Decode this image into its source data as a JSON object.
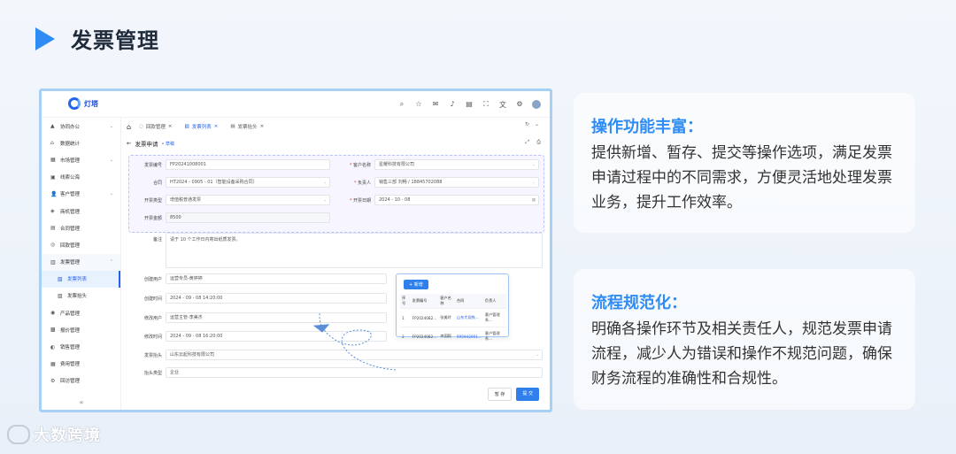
{
  "header": {
    "title": "发票管理"
  },
  "app": {
    "logo_text": "灯塔",
    "sidebar": [
      {
        "icon": "▲",
        "label": "协同办公",
        "chev": "⌄"
      },
      {
        "icon": "⌂",
        "label": "数据统计",
        "chev": ""
      },
      {
        "icon": "▦",
        "label": "市场管理",
        "chev": "⌄"
      },
      {
        "icon": "▣",
        "label": "线索公海",
        "chev": ""
      },
      {
        "icon": "👤",
        "label": "客户管理",
        "chev": "⌄"
      },
      {
        "icon": "◈",
        "label": "商机管理",
        "chev": ""
      },
      {
        "icon": "▤",
        "label": "合同管理",
        "chev": ""
      },
      {
        "icon": "◎",
        "label": "回款管理",
        "chev": ""
      },
      {
        "icon": "▥",
        "label": "发票管理",
        "chev": "⌃"
      },
      {
        "icon": "▧",
        "label": "发票列表",
        "chev": ""
      },
      {
        "icon": "▨",
        "label": "发票抬头",
        "chev": ""
      },
      {
        "icon": "◉",
        "label": "产品管理",
        "chev": ""
      },
      {
        "icon": "▩",
        "label": "报价管理",
        "chev": ""
      },
      {
        "icon": "◐",
        "label": "销售管理",
        "chev": ""
      },
      {
        "icon": "▦",
        "label": "费用管理",
        "chev": ""
      },
      {
        "icon": "⚙",
        "label": "回访管理",
        "chev": ""
      }
    ],
    "collapse": "«",
    "tabs": [
      {
        "label": "回款管理",
        "close": "×"
      },
      {
        "label": "发票列表",
        "close": "×"
      },
      {
        "label": "发票抬头",
        "close": "×"
      }
    ],
    "page_title": "发票申请",
    "draft_badge": "• 草稿",
    "form": {
      "invoice_no_label": "发票编号",
      "invoice_no": "FP20241008001",
      "customer_label": "客户名称",
      "customer": "星耀科技有限公司",
      "contract_label": "合同",
      "contract": "HT2024 - 0905 - 01（智能设备采购合同）",
      "owner_label": "负责人",
      "owner": "销售三部 刘畅 / 18845702088",
      "type_label": "开票类型",
      "type": "增值税普通发票",
      "date_label": "开票日期",
      "date": "2024 - 10 - 08",
      "amount_label": "开票金额",
      "amount": "8500",
      "remark_label": "备注",
      "remark": "请于 10 个工作日内寄出纸质发票。",
      "creator_label": "创建用户",
      "creator": "运营专员-黄婷婷",
      "created_label": "创建时间",
      "created": "2024 - 09 - 08  14:20:00",
      "modifier_label": "修改用户",
      "modifier": "运营主管-李美杰",
      "modified_label": "修改时间",
      "modified": "2024 - 09 - 08  16:20:00",
      "title_label": "发票抬头",
      "title": "山东云起科技有限公司",
      "title_type_label": "抬头类型",
      "title_type": "企业"
    },
    "popup": {
      "add": "+ 新增",
      "columns": [
        "序号",
        "发票编号",
        "客户名称",
        "合同",
        "负责人"
      ],
      "rows": [
        [
          "1",
          "FP2024082...",
          "张美玲",
          "山东大观铁...",
          "客户管理系..."
        ],
        [
          "2",
          "FP2024082...",
          "李国毅",
          "595942001...",
          "客户管理系..."
        ]
      ]
    },
    "buttons": {
      "draft": "暂 存",
      "submit": "提 交"
    }
  },
  "cards": [
    {
      "title": "操作功能丰富：",
      "body": "提供新增、暂存、提交等操作选项，满足发票申请过程中的不同需求，方便灵活地处理发票业务，提升工作效率。"
    },
    {
      "title": "流程规范化：",
      "body": "明确各操作环节及相关责任人，规范发票申请流程，减少人为错误和操作不规范问题，确保财务流程的准确性和合规性。"
    }
  ],
  "watermark": "大数跨境"
}
